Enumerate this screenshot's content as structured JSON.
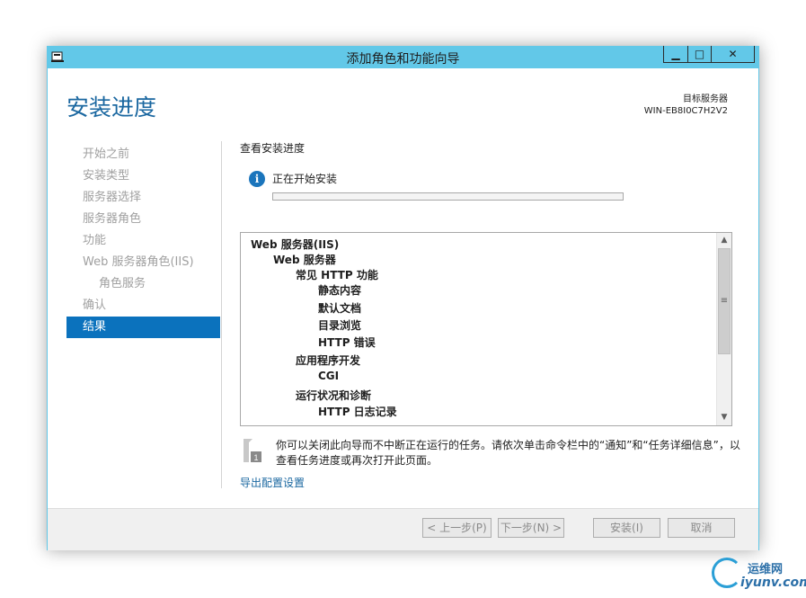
{
  "window": {
    "title": "添加角色和功能向导",
    "controls": {
      "minimize": "▁",
      "maximize": "□",
      "close": "✕"
    }
  },
  "header": {
    "page_title": "安装进度",
    "target_label": "目标服务器",
    "target_server": "WIN-EB8I0C7H2V2"
  },
  "nav": {
    "items": [
      {
        "label": "开始之前",
        "state": "disabled",
        "indent": 0
      },
      {
        "label": "安装类型",
        "state": "disabled",
        "indent": 0
      },
      {
        "label": "服务器选择",
        "state": "disabled",
        "indent": 0
      },
      {
        "label": "服务器角色",
        "state": "disabled",
        "indent": 0
      },
      {
        "label": "功能",
        "state": "disabled",
        "indent": 0
      },
      {
        "label": "Web 服务器角色(IIS)",
        "state": "disabled",
        "indent": 0
      },
      {
        "label": "角色服务",
        "state": "disabled",
        "indent": 1
      },
      {
        "label": "确认",
        "state": "disabled",
        "indent": 0
      },
      {
        "label": "结果",
        "state": "active",
        "indent": 0
      }
    ]
  },
  "main": {
    "section_title": "查看安装进度",
    "status_icon": "info-icon",
    "status_text": "正在开始安装",
    "progress_fraction": 0.0,
    "tree": [
      {
        "label": "Web 服务器(IIS)",
        "level": 0
      },
      {
        "label": "Web 服务器",
        "level": 1
      },
      {
        "label": "常见 HTTP 功能",
        "level": 2
      },
      {
        "label": "静态内容",
        "level": 3
      },
      {
        "label": "默认文档",
        "level": 3
      },
      {
        "label": "目录浏览",
        "level": 3
      },
      {
        "label": "HTTP 错误",
        "level": 3
      },
      {
        "label": "应用程序开发",
        "level": 2
      },
      {
        "label": "CGI",
        "level": 3
      },
      {
        "label": "运行状况和诊断",
        "level": 2
      },
      {
        "label": "HTTP 日志记录",
        "level": 3
      }
    ],
    "note_text": "你可以关闭此向导而不中断正在运行的任务。请依次单击命令栏中的“通知”和“任务详细信息”，以查看任务进度或再次打开此页面。",
    "export_link": "导出配置设置"
  },
  "footer": {
    "prev_label": "< 上一步(P)",
    "next_label": "下一步(N) >",
    "install_label": "安装(I)",
    "cancel_label": "取消"
  },
  "watermark": {
    "cn": "运维网",
    "en": "iyunv.com"
  },
  "colors": {
    "accent": "#62c8e8",
    "heading": "#1a67a0",
    "nav_active": "#0b72bd",
    "info": "#1b75bc"
  }
}
